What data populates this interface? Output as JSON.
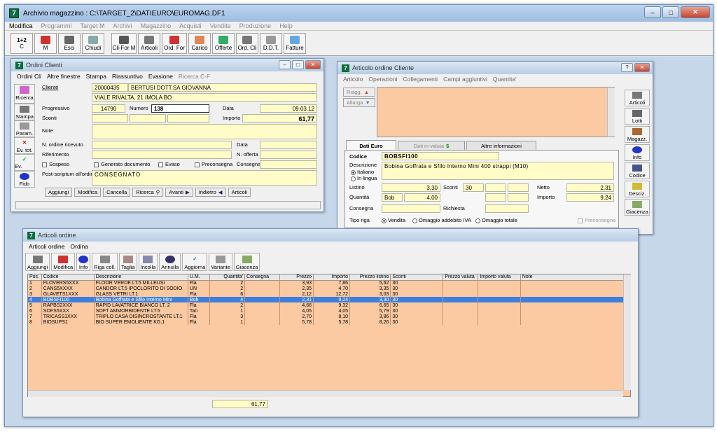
{
  "app": {
    "title": "Archivio magazzino : C:\\TARGET_2\\DATIEURO\\EUROMAG.DF1",
    "icon_letter": "7",
    "controls": {
      "minimize": "–",
      "maximize": "□",
      "close": "✕"
    }
  },
  "menu": [
    {
      "label": "Modifica",
      "enabled": true
    },
    {
      "label": "Programmi",
      "enabled": false
    },
    {
      "label": "Target M",
      "enabled": false
    },
    {
      "label": "Archivi",
      "enabled": false
    },
    {
      "label": "Magazzino",
      "enabled": false
    },
    {
      "label": "Acquisti",
      "enabled": false
    },
    {
      "label": "Vendite",
      "enabled": false
    },
    {
      "label": "Produzione",
      "enabled": false
    },
    {
      "label": "Help",
      "enabled": false
    }
  ],
  "toolbar": {
    "calc": {
      "top": "1+2",
      "label": "C"
    },
    "m": "M",
    "esci": "Esci",
    "chiudi": "Chiudi",
    "cliform": "Cli-For M",
    "articoli": "Articoli",
    "ordfor": "Ord. For",
    "carico": "Carico",
    "offerte": "Offerte",
    "ordcli": "Ord. Cli",
    "ddt": "D.D.T.",
    "fatture": "Fatture"
  },
  "ordini": {
    "title": "Ordini Clienti",
    "menu": [
      "Ordini Cli",
      "Altre finestre",
      "Stampa",
      "Riassuntivo",
      "Evasione"
    ],
    "menu_disabled": "Ricerca C-F",
    "side": {
      "ricerca": "Ricerca",
      "stampa": "Stampa",
      "param": "Param.",
      "evtot": "Ev. tot.",
      "evparz": "Ev. parz.",
      "fido": "Fido"
    },
    "labels": {
      "cliente": "Cliente",
      "progressivo": "Progressivo",
      "numero": "Numero",
      "data": "Data",
      "sconti": "Sconti",
      "importo": "Importo",
      "note": "Note",
      "nordine": "N. ordine ricevuto",
      "data2": "Data",
      "riferimento": "Riferimento",
      "noffe": "N. offerta",
      "sospeso": "Sospeso",
      "generato": "Generato documento",
      "evaso": "Evaso",
      "preconsegna": "Preconsegna",
      "consegna": "Consegna",
      "postscriptum": "Post-scriptum all'ordine"
    },
    "values": {
      "cliente_code": "20000435",
      "cliente_name": "BERTUSI DOTT.SA GIOVANNA",
      "indirizzo": "VIALE RIVALTA, 21   IMOLA   BO",
      "progressivo": "14790",
      "numero": "138",
      "data": "09.03.12",
      "importo": "61,77",
      "postscriptum": "CONSEGNATO"
    },
    "buttons": [
      "Aggiungi",
      "Modifica",
      "Cancella",
      "Ricerca",
      "Avanti",
      "Indietro",
      "Articoli"
    ]
  },
  "articolo": {
    "title": "Articolo ordine Cliente",
    "menu": [
      "Articolo",
      "Operazioni",
      "Collegamenti",
      "Campi aggiuntivi",
      "Quantita'"
    ],
    "riagg": "Riagg.",
    "allarga": "Allarga",
    "tabs": [
      "Dati Euro",
      "Dati in valuta",
      "Altre informazioni"
    ],
    "tab_symbols": {
      "valuta": "$"
    },
    "labels": {
      "codice": "Codice",
      "descrizione": "Descrizione",
      "italiano": "Italiano",
      "inlingua": "In lingua",
      "listino": "Listino",
      "sconti": "Sconti",
      "netto": "Netto",
      "quantita": "Quantità",
      "importo": "Importo",
      "consegna": "Consegna",
      "richiesta": "Richiesta",
      "tiporiga": "Tipo riga",
      "vendita": "Vendita",
      "omaggioiva": "Omaggio addebito IVA",
      "omaggiotot": "Omaggio totale",
      "preconsegna": "Preconsegna"
    },
    "values": {
      "codice": "BOBSFI100",
      "descrizione": "Bobina Goffrata e Sfilo Interno Mini 400 strappi (M10)",
      "listino": "3,30",
      "sconto1": "30",
      "netto": "2,31",
      "um": "Bob",
      "quantita": "4,00",
      "importo": "9,24"
    },
    "side": {
      "articoli": "Articoli",
      "lotti": "Lotti",
      "magazz": "Magazz.",
      "info": "Info",
      "codice": "Codice",
      "desc": "Desciz.",
      "giacenza": "Giacenza"
    },
    "title_controls": {
      "help": "?"
    }
  },
  "articoli_ordine": {
    "title": "Articoli ordine",
    "menu": [
      "Articoli ordine",
      "Ordina"
    ],
    "toolbar": [
      "Aggiungi",
      "Modifica",
      "Info",
      "Riga coll.",
      "Taglia",
      "Incolla",
      "Annulla",
      "Aggiorna",
      "Variante",
      "Giacenza"
    ],
    "columns": [
      "Pos.",
      "Codice",
      "Descrizione",
      "U.M.",
      "Quantita'",
      "Consegna",
      "Prezzo",
      "Importo",
      "Prezzo listino",
      "Sconti",
      "Prezzo valuta",
      "Importo valuta",
      "Note"
    ],
    "rows": [
      [
        "1",
        "FLOVERS5XXX",
        "FLOOR VERDE LT.5 MILLEUSI",
        "Fla",
        "2",
        "",
        "3,93",
        "7,86",
        "5,62",
        "30"
      ],
      [
        "2",
        "CANS5XXXX",
        "CANDOR LT.5 IPOCLORITO DI SODIO",
        "UN",
        "2",
        "",
        "2,35",
        "4,70",
        "3,35",
        "30"
      ],
      [
        "3",
        "GLAVETS1XXX",
        "GLASS VETRI LT.1",
        "Fla",
        "6",
        "",
        "2,12",
        "12,72",
        "3,03",
        "30"
      ],
      [
        "4",
        "BOBSFI100",
        "Bobina Goffrata e Sfilo Interno Mini",
        "Bob",
        "4",
        "",
        "2,31",
        "9,24",
        "3,30",
        "30"
      ],
      [
        "5",
        "RAPBS2XXX",
        "RAPID LAVATRICE BIANCO LT. 2",
        "Fla",
        "2",
        "",
        "4,66",
        "9,32",
        "6,65",
        "30"
      ],
      [
        "6",
        "SOFS5XXX",
        "SOFT AMMORBIDENTE LT.5",
        "Tan",
        "1",
        "",
        "4,05",
        "4,05",
        "5,79",
        "30"
      ],
      [
        "7",
        "TRICASS1XXX",
        "TRIPLO CASA DISINCROSTANTE LT.1",
        "Fla",
        "3",
        "",
        "2,70",
        "8,10",
        "3,86",
        "30"
      ],
      [
        "8",
        "BIOSUPS1",
        "BIO SUPER EMOLIENTE KG.1",
        "Fla",
        "1",
        "",
        "5,78",
        "5,78",
        "8,26",
        "30"
      ]
    ],
    "selected_row": 3,
    "total": "61,77"
  },
  "colors": {
    "field": "#fffcc8",
    "grid": "#fbc9a2",
    "selection": "#3d7fde",
    "title": "#b8cde5"
  }
}
